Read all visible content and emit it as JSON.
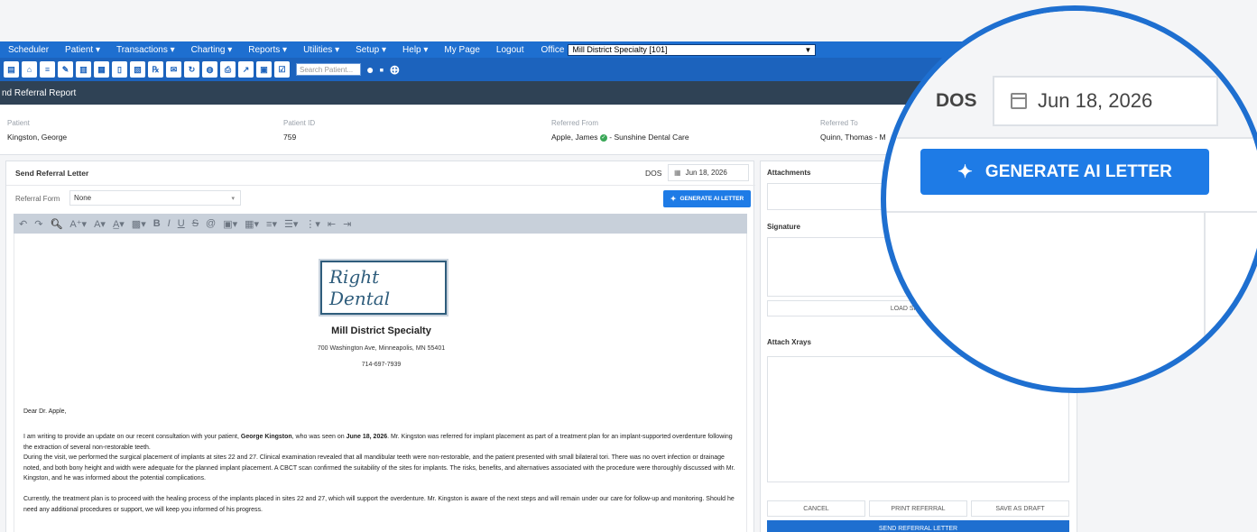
{
  "menu": {
    "items": [
      "Scheduler",
      "Patient ▾",
      "Transactions ▾",
      "Charting ▾",
      "Reports ▾",
      "Utilities ▾",
      "Setup ▾",
      "Help ▾",
      "My Page",
      "Logout"
    ],
    "office_label": "Office",
    "office_value": "Mill District Specialty [101]"
  },
  "toolbar": {
    "search_placeholder": "Search Patient..."
  },
  "title_bar": "nd Referral Report",
  "patient_info": {
    "patient_label": "Patient",
    "patient_value": "Kingston, George",
    "patient_id_label": "Patient ID",
    "patient_id_value": "759",
    "referred_from_label": "Referred From",
    "referred_from_value": "Apple, James",
    "referred_from_practice": "- Sunshine Dental Care",
    "referred_to_label": "Referred To",
    "referred_to_value": "Quinn, Thomas - M"
  },
  "letter_panel": {
    "heading": "Send Referral Letter",
    "dos_label": "DOS",
    "dos_value": "Jun 18, 2026",
    "referral_form_label": "Referral Form",
    "referral_form_value": "None",
    "generate_button": "GENERATE AI LETTER"
  },
  "document": {
    "logo_text": "Right Dental",
    "practice_name": "Mill District Specialty",
    "address": "700 Washington Ave, Minneapolis, MN 55401",
    "phone": "714-697-7939",
    "salutation": "Dear Dr. Apple,",
    "p1_a": "I am writing to provide an update on our recent consultation with your patient, ",
    "p1_patient": "George Kingston",
    "p1_b": ", who was seen on ",
    "p1_date": "June 18, 2026",
    "p1_c": ". Mr. Kingston was referred for implant placement as part of a treatment plan for an implant-supported overdenture following the extraction of several non-restorable teeth.",
    "p2": "During the visit, we performed the surgical placement of implants at sites 22 and 27. Clinical examination revealed that all mandibular teeth were non-restorable, and the patient presented with small bilateral tori. There was no overt infection or drainage noted, and both bony height and width were adequate for the planned implant placement. A CBCT scan confirmed the suitability of the sites for implants. The risks, benefits, and alternatives associated with the procedure were thoroughly discussed with Mr. Kingston, and he was informed about the potential complications.",
    "p3": "Currently, the treatment plan is to proceed with the healing process of the implants placed in sites 22 and 27, which will support the overdenture. Mr. Kingston is aware of the next steps and will remain under our care for follow-up and monitoring. Should he need any additional procedures or support, we will keep you informed of his progress."
  },
  "right_panel": {
    "attachments_label": "Attachments",
    "signature_label": "Signature",
    "load_signature": "LOAD SIGNATURE",
    "attach_xrays_label": "Attach Xrays",
    "cancel": "CANCEL",
    "print_referral": "PRINT REFERRAL",
    "save_as_draft": "SAVE AS DRAFT",
    "send_referral": "SEND REFERRAL LETTER"
  },
  "zoom": {
    "dos_label": "DOS",
    "dos_value": "Jun 18, 2026",
    "generate_button": "GENERATE AI LETTER"
  }
}
